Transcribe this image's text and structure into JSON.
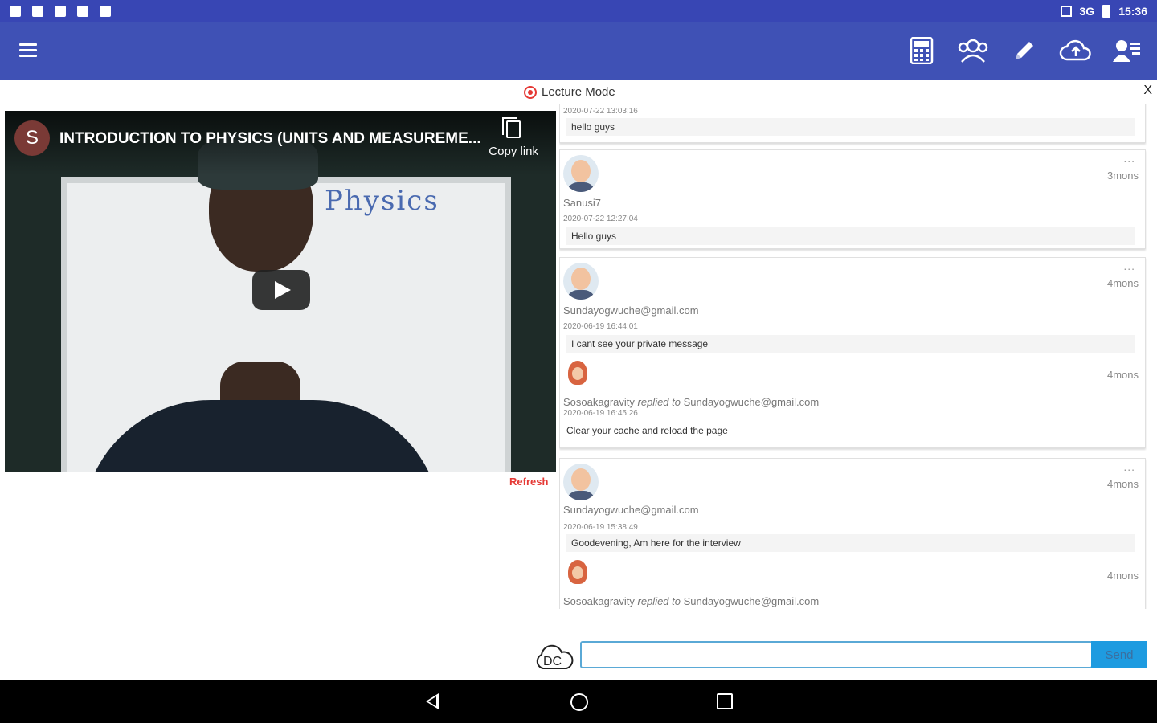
{
  "status_bar": {
    "network": "3G",
    "time": "15:36"
  },
  "app_bar": {
    "menu_icon": "hamburger-icon",
    "tools": [
      "calculator-icon",
      "users-icon",
      "pencil-icon",
      "cloud-upload-icon",
      "person-card-icon"
    ]
  },
  "lecture": {
    "mode_label": "Lecture Mode",
    "close": "X"
  },
  "video": {
    "channel_initial": "S",
    "title": "INTRODUCTION TO PHYSICS (UNITS AND MEASUREME...",
    "copy_link": "Copy link",
    "board_text": "Physics",
    "refresh": "Refresh"
  },
  "feed": {
    "top_partial": {
      "timestamp": "2020-07-22 13:03:16",
      "message": "hello guys"
    },
    "posts": [
      {
        "user": "Sanusi7",
        "ago": "3mons",
        "timestamp": "2020-07-22 12:27:04",
        "message": "Hello guys"
      },
      {
        "user": "Sundayogwuche@gmail.com",
        "ago": "4mons",
        "timestamp": "2020-06-19 16:44:01",
        "message": "I cant see your private message",
        "reply": {
          "user": "Sosoakagravity",
          "replied_to": "replied to",
          "target": "Sundayogwuche@gmail.com",
          "ago": "4mons",
          "timestamp": "2020-06-19 16:45:26",
          "message": "Clear your cache and reload the page"
        }
      },
      {
        "user": "Sundayogwuche@gmail.com",
        "ago": "4mons",
        "timestamp": "2020-06-19 15:38:49",
        "message": "Goodevening, Am here for the interview",
        "reply": {
          "user": "Sosoakagravity",
          "replied_to": "replied to",
          "target": "Sundayogwuche@gmail.com",
          "ago": "4mons"
        }
      }
    ],
    "more_icon": "..."
  },
  "composer": {
    "logo_text": "DC",
    "input_value": "",
    "send_label": "Send"
  }
}
